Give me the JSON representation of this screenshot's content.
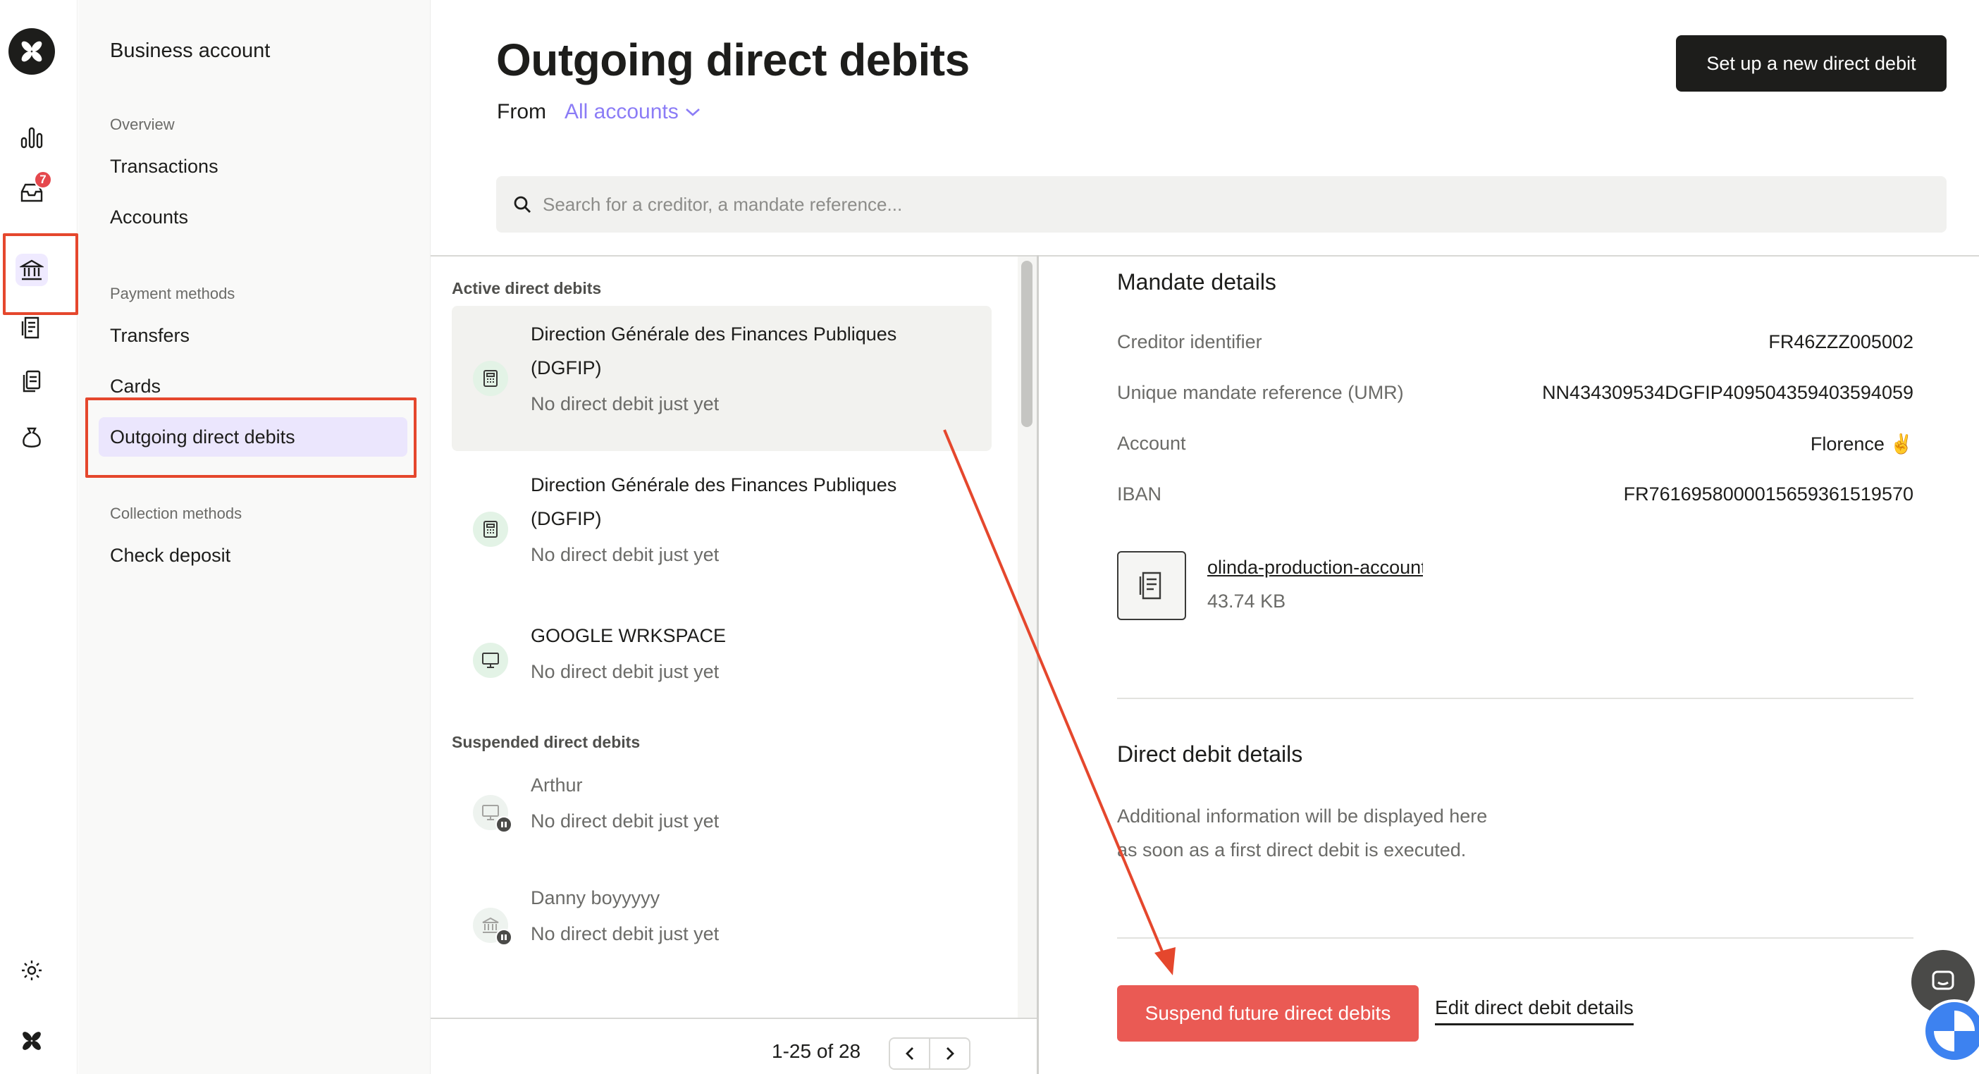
{
  "rail": {
    "notifications_count": "7"
  },
  "subnav": {
    "title": "Business account",
    "sections": [
      {
        "label": "Overview",
        "items": [
          "Transactions",
          "Accounts"
        ]
      },
      {
        "label": "Payment methods",
        "items": [
          "Transfers",
          "Cards",
          "Outgoing direct debits"
        ]
      },
      {
        "label": "Collection methods",
        "items": [
          "Check deposit"
        ]
      }
    ],
    "active_item": "Outgoing direct debits"
  },
  "header": {
    "title": "Outgoing direct debits",
    "from_label": "From",
    "account_select": "All accounts",
    "primary_button": "Set up a new direct debit"
  },
  "search": {
    "placeholder": "Search for a creditor, a mandate reference..."
  },
  "list": {
    "active_heading": "Active direct debits",
    "suspended_heading": "Suspended direct debits",
    "active_items": [
      {
        "title_line1": "Direction Générale des Finances Publiques",
        "title_line2": "(DGFIP)",
        "subtitle": "No direct debit just yet",
        "icon": "calculator-icon"
      },
      {
        "title_line1": "Direction Générale des Finances Publiques",
        "title_line2": "(DGFIP)",
        "subtitle": "No direct debit just yet",
        "icon": "calculator-icon"
      },
      {
        "title_line1": "GOOGLE WRKSPACE",
        "subtitle": "No direct debit just yet",
        "icon": "monitor-icon"
      }
    ],
    "suspended_items": [
      {
        "title": "Arthur",
        "subtitle": "No direct debit just yet",
        "icon": "monitor-icon"
      },
      {
        "title": "Danny boyyyyy",
        "subtitle": "No direct debit just yet",
        "icon": "bank-icon"
      }
    ],
    "pagination": "1-25 of 28"
  },
  "details": {
    "mandate_title": "Mandate details",
    "fields": [
      {
        "label": "Creditor identifier",
        "value": "FR46ZZZ005002"
      },
      {
        "label": "Unique mandate reference (UMR)",
        "value": "NN434309534DGFIP409504359403594059"
      },
      {
        "label": "Account",
        "value": "Florence ✌️"
      },
      {
        "label": "IBAN",
        "value": "FR7616958000015659361519570"
      }
    ],
    "attachment": {
      "name": "olinda-production-account",
      "size": "43.74 KB"
    },
    "debit_title": "Direct debit details",
    "debit_info": "Additional information will be displayed here as soon as a first direct debit is executed.",
    "suspend_button": "Suspend future direct debits",
    "edit_button": "Edit direct debit details"
  },
  "colors": {
    "accent": "#8b7cf6",
    "danger": "#ea5a54",
    "annotation": "#e5472d",
    "primary": "#1d1d1b"
  }
}
